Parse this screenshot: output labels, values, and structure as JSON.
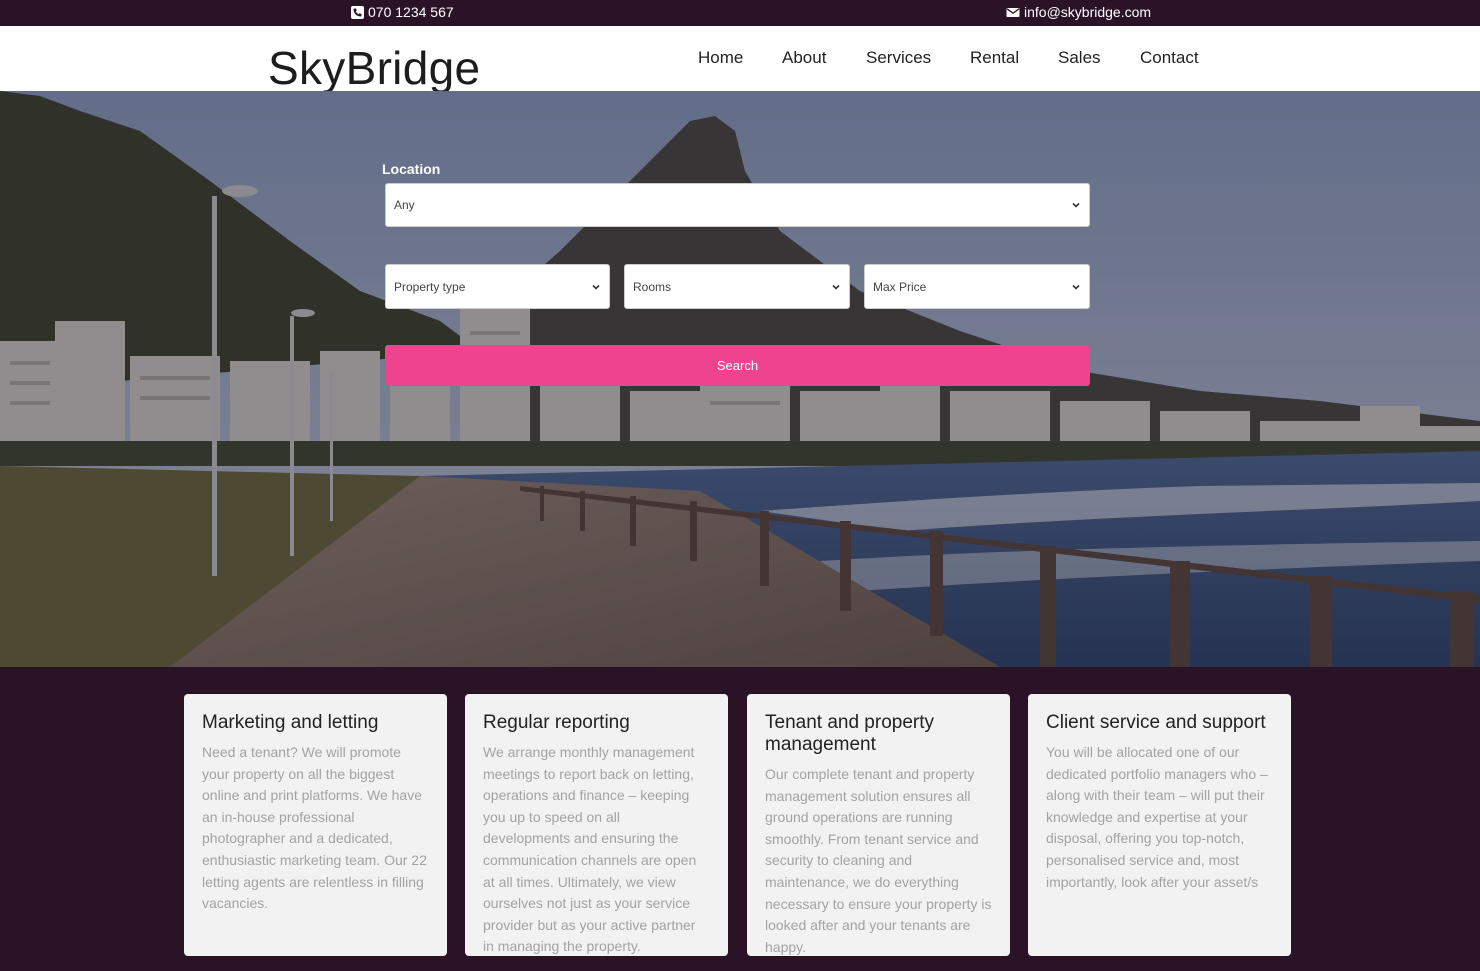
{
  "topbar": {
    "phone": "070 1234 567",
    "email": "info@skybridge.com",
    "phone_icon": "phone-icon",
    "email_icon": "envelope-icon"
  },
  "header": {
    "logo": "SkyBridge",
    "nav": [
      "Home",
      "About",
      "Services",
      "Rental",
      "Sales",
      "Contact"
    ]
  },
  "search": {
    "location_label": "Location",
    "location_value": "Any",
    "property_type": "Property type",
    "rooms": "Rooms",
    "max_price": "Max Price",
    "button": "Search"
  },
  "cards": [
    {
      "title": "Marketing and letting",
      "text": "Need a tenant? We will promote your property on all the biggest online and print platforms. We have an in-house professional photographer and a dedicated, enthusiastic marketing team. Our 22 letting agents are relentless in filling vacancies."
    },
    {
      "title": "Regular reporting",
      "text": "We arrange monthly management meetings to report back on letting, operations and finance – keeping you up to speed on all developments and ensuring the communication channels are open at all times. Ultimately, we view ourselves not just as your service provider but as your active partner in managing the property."
    },
    {
      "title": "Tenant and property management",
      "text": "Our complete tenant and property management solution ensures all ground operations are running smoothly. From tenant service and security to cleaning and maintenance, we do everything necessary to ensure your property is looked after and your tenants are happy."
    },
    {
      "title": "Client service and support",
      "text": "You will be allocated one of our dedicated portfolio managers who – along with their team – will put their knowledge and expertise at your disposal, offering you top-notch, personalised service and, most importantly, look after your asset/s"
    }
  ],
  "colors": {
    "brand_dark": "#2b1327",
    "accent": "#ee4490",
    "card_bg": "#f2f2f2"
  }
}
